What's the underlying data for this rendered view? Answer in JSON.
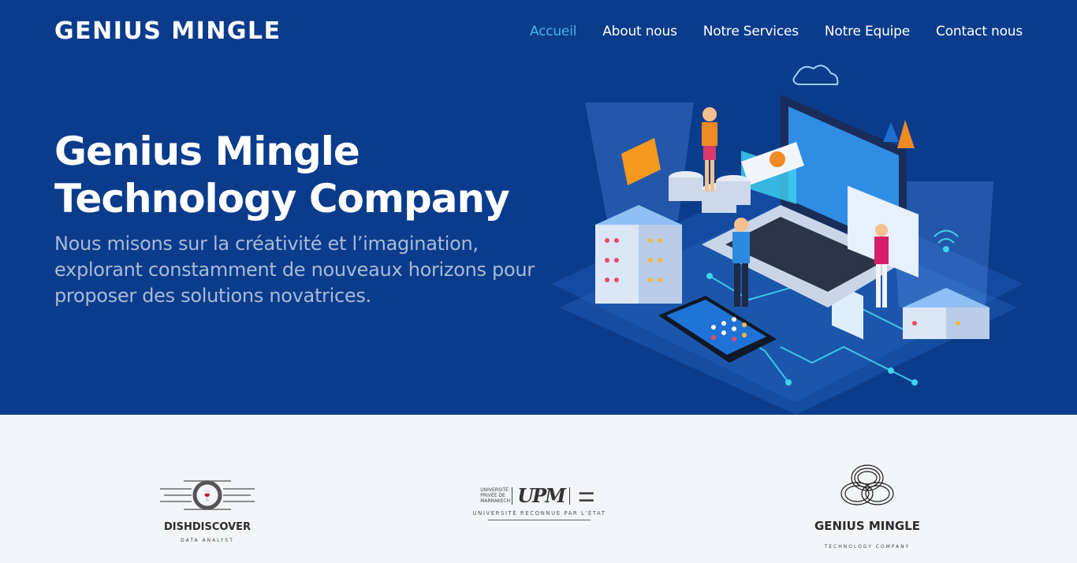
{
  "header": {
    "brand": "GENIUS MINGLE",
    "nav": [
      {
        "label": "Accueil",
        "active": true
      },
      {
        "label": "About nous",
        "active": false
      },
      {
        "label": "Notre Services",
        "active": false
      },
      {
        "label": "Notre Equipe",
        "active": false
      },
      {
        "label": "Contact nous",
        "active": false
      }
    ]
  },
  "hero": {
    "title_line1": "Genius Mingle",
    "title_line2": "Technology Company",
    "subtitle_line1": "Nous misons sur la créativité et l’imagination,",
    "subtitle_line2": "explorant constamment de nouveaux horizons pour",
    "subtitle_line3": "proposer des solutions novatrices."
  },
  "clients": [
    {
      "name": "DISHDISCOVER",
      "tagline": "DATA ANALYST"
    },
    {
      "name_left": "UNIVERSITÉ PRIVÉE DE MARRAKECH",
      "mark": "UPM",
      "tagline": "UNIVERSITÉ RECONNUE PAR L'ÉTAT"
    },
    {
      "name": "GENIUS MINGLE",
      "tagline": "TECHNOLOGY COMPANY"
    }
  ],
  "colors": {
    "hero_bg": "#0b3c8c",
    "accent": "#47b2e4",
    "subtitle": "#a9bad6",
    "clients_bg": "#f3f5fa"
  }
}
